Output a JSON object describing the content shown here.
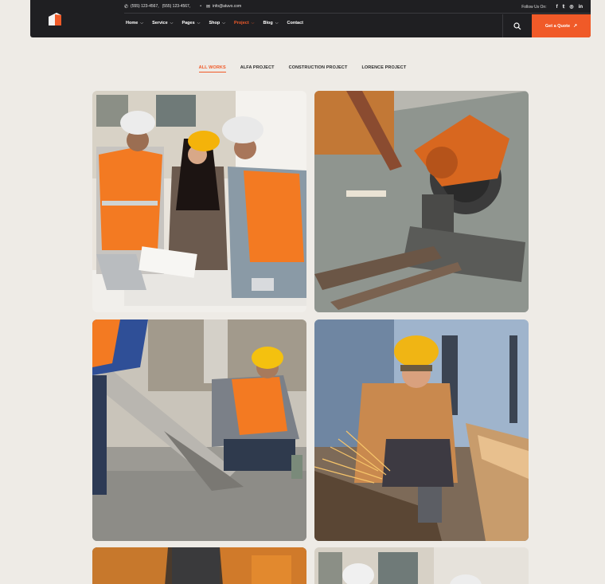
{
  "header": {
    "logo_icon": "house-logo-icon",
    "topbar": {
      "phone_icon": "phone-icon",
      "phone_1": "(555) 123-4567,",
      "phone_2": "(555) 123-4567,",
      "email_icon": "mail-icon",
      "email": "info@atuvo.com",
      "follow_label": "Follow Us On:",
      "socials": [
        "facebook-icon",
        "twitter-icon",
        "whatsapp-icon",
        "linkedin-icon"
      ]
    },
    "nav": [
      {
        "label": "Home",
        "dropdown": true,
        "active": false
      },
      {
        "label": "Service",
        "dropdown": true,
        "active": false
      },
      {
        "label": "Pages",
        "dropdown": true,
        "active": false
      },
      {
        "label": "Shop",
        "dropdown": true,
        "active": false
      },
      {
        "label": "Project",
        "dropdown": true,
        "active": true
      },
      {
        "label": "Blog",
        "dropdown": true,
        "active": false
      },
      {
        "label": "Contact",
        "dropdown": false,
        "active": false
      }
    ],
    "search_icon": "search-icon",
    "quote_button": "Get a Quote",
    "accent_color": "#f05a28"
  },
  "filters": {
    "items": [
      "ALL WORKS",
      "ALFA PROJECT",
      "CONSTRUCTION PROJECT",
      "LORENCE PROJECT"
    ],
    "active": "ALL WORKS"
  },
  "gallery": {
    "items": [
      {
        "subject": "workers-reviewing-blueprints-photo"
      },
      {
        "subject": "orange-cutoff-saw-photo"
      },
      {
        "subject": "workers-pouring-concrete-photo"
      },
      {
        "subject": "worker-grinding-metal-sparks-photo"
      },
      {
        "subject": "workers-orange-gear-photo"
      },
      {
        "subject": "workers-hardhats-building-photo"
      }
    ]
  }
}
